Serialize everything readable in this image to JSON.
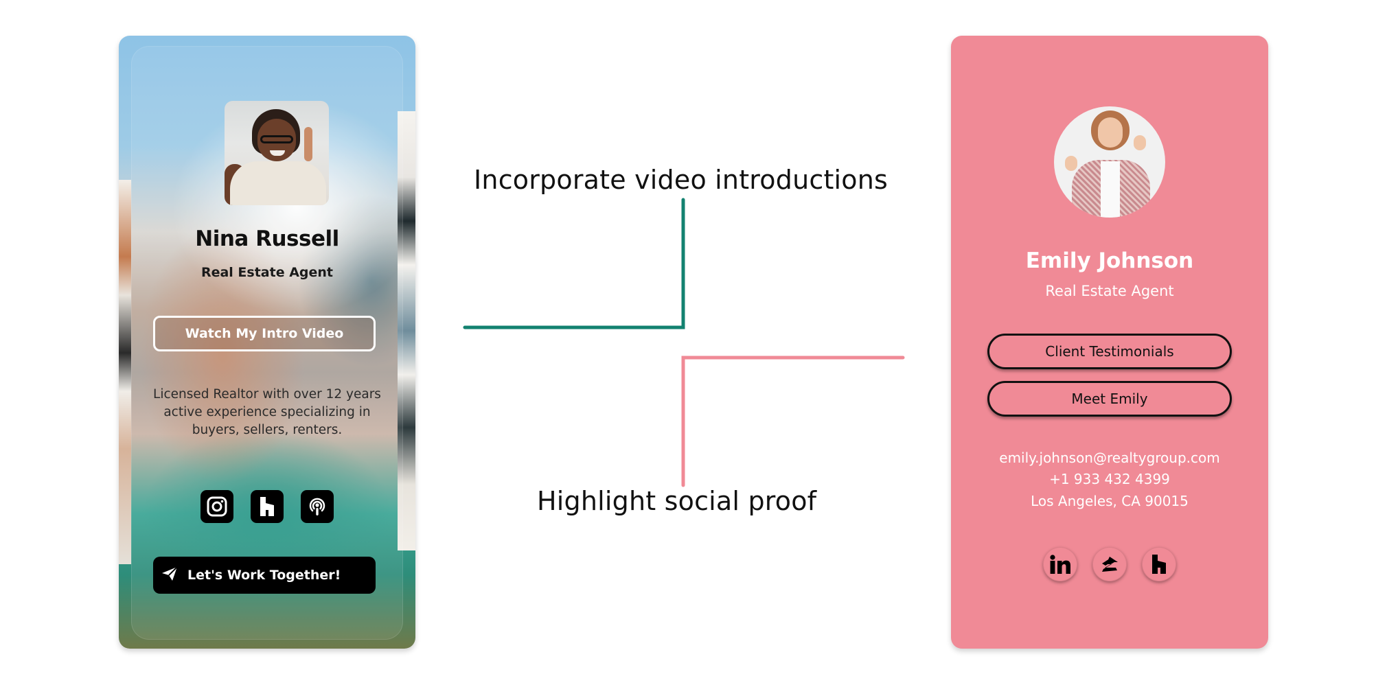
{
  "annotations": {
    "video": "Incorporate video introductions",
    "social": "Highlight social proof"
  },
  "colors": {
    "video_connector": "#138270",
    "social_connector": "#f08a96",
    "emily_card_bg": "#f08a96"
  },
  "left_card": {
    "name": "Nina Russell",
    "title": "Real Estate Agent",
    "video_button": "Watch My Intro Video",
    "bio": "Licensed Realtor with over 12 years active experience specializing in buyers, sellers, renters.",
    "socials": [
      {
        "icon": "instagram-icon"
      },
      {
        "icon": "houzz-icon"
      },
      {
        "icon": "podcast-icon"
      }
    ],
    "cta_icon": "paper-plane-icon",
    "cta_button": "Let's Work Together!"
  },
  "right_card": {
    "name": "Emily Johnson",
    "title": "Real Estate Agent",
    "buttons": [
      "Client Testimonials",
      "Meet Emily"
    ],
    "email": "emily.johnson@realtygroup.com",
    "phone": "+1 933 432 4399",
    "address": "Los Angeles, CA 90015",
    "socials": [
      {
        "icon": "linkedin-icon"
      },
      {
        "icon": "zillow-icon"
      },
      {
        "icon": "houzz-icon"
      }
    ]
  }
}
